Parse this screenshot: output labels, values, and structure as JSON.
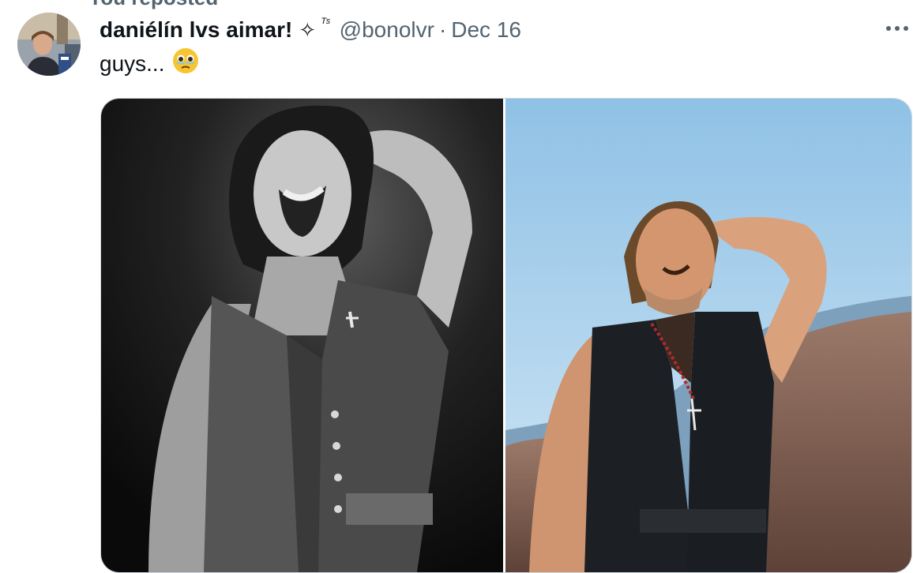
{
  "repost": {
    "label": "You reposted"
  },
  "tweet": {
    "display_name": "daniélín lvs aimar!",
    "name_emoji": "✧",
    "name_superscript": "ᵀˢ",
    "handle": "@bonolvr",
    "separator": "·",
    "date": "Dec 16",
    "text": "guys...",
    "text_emoji": "face-holding-back-tears"
  },
  "media": {
    "photos": [
      {
        "description": "black-and-white-singer-photo"
      },
      {
        "description": "color-singer-photo"
      }
    ]
  },
  "icons": {
    "more": "more-horizontal-icon",
    "repost": "repost-icon"
  },
  "colors": {
    "text": "#0f1419",
    "secondary": "#536471",
    "border": "#cfd9de"
  }
}
